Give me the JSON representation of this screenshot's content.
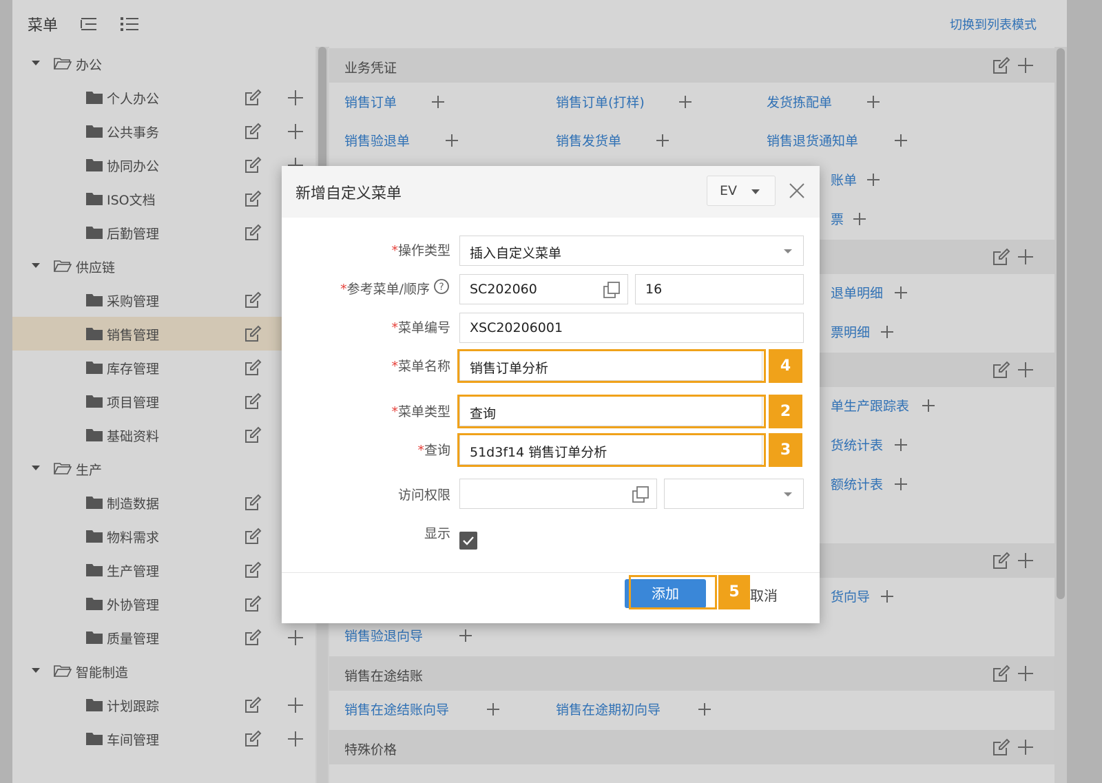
{
  "topbar": {
    "title": "菜单",
    "switch_label": "切换到列表模式"
  },
  "sidebar": {
    "groups": [
      {
        "label": "办公",
        "items": [
          "个人办公",
          "公共事务",
          "协同办公",
          "ISO文档",
          "后勤管理"
        ]
      },
      {
        "label": "供应链",
        "items": [
          "采购管理",
          "销售管理",
          "库存管理",
          "项目管理",
          "基础资料"
        ]
      },
      {
        "label": "生产",
        "items": [
          "制造数据",
          "物料需求",
          "生产管理",
          "外协管理",
          "质量管理"
        ]
      },
      {
        "label": "智能制造",
        "items": [
          "计划跟踪",
          "车间管理"
        ]
      }
    ],
    "selected_item": "销售管理"
  },
  "main": {
    "groups": [
      {
        "title": "业务凭证",
        "links": [
          "销售订单",
          "销售订单(打样)",
          "发货拣配单",
          "销售验退单",
          "销售发货单",
          "销售退货通知单",
          "账单",
          "票"
        ]
      },
      {
        "title": "",
        "links": [
          "退单明细",
          "票明细"
        ]
      },
      {
        "title": "",
        "links": [
          "单生产跟踪表",
          "货统计表",
          "额统计表"
        ]
      },
      {
        "title": "",
        "links": [
          "货向导",
          "销售验退向导"
        ]
      },
      {
        "title": "销售在途结账",
        "links": [
          "销售在途结账向导",
          "销售在途期初向导"
        ]
      },
      {
        "title": "特殊价格",
        "links": []
      }
    ]
  },
  "dialog": {
    "title": "新增自定义菜单",
    "ev_label": "EV",
    "fields": {
      "op_type": {
        "label": "操作类型",
        "value": "插入自定义菜单"
      },
      "ref_menu": {
        "label": "参考菜单/顺序",
        "value": "SC202060",
        "order": "16"
      },
      "menu_code": {
        "label": "菜单编号",
        "value": "XSC20206001"
      },
      "menu_name": {
        "label": "菜单名称",
        "value": "销售订单分析"
      },
      "menu_type": {
        "label": "菜单类型",
        "value": "查询"
      },
      "query": {
        "label": "查询",
        "value": "51d3f14 销售订单分析"
      },
      "access": {
        "label": "访问权限",
        "value": ""
      },
      "show": {
        "label": "显示",
        "checked": true
      }
    },
    "required_mark": "*",
    "badges": {
      "menu_name": "4",
      "menu_type": "2",
      "query": "3",
      "add": "5"
    },
    "add_label": "添加",
    "cancel_label": "取消"
  },
  "colors": {
    "accent": "#3a87d8",
    "highlight": "#f0a21a",
    "required": "#e5403a",
    "selected_row": "#fbeed7"
  }
}
